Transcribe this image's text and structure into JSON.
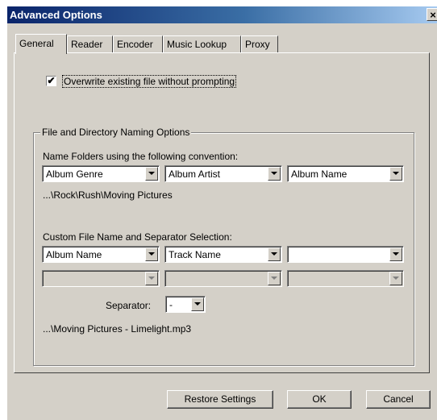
{
  "window": {
    "title": "Advanced Options",
    "close_glyph": "×"
  },
  "tabs": [
    {
      "label": "General",
      "active": true
    },
    {
      "label": "Reader"
    },
    {
      "label": "Encoder"
    },
    {
      "label": "Music Lookup"
    },
    {
      "label": "Proxy"
    }
  ],
  "overwrite": {
    "checked": true,
    "check_glyph": "✔",
    "label": "Overwrite existing file without prompting"
  },
  "naming": {
    "group_title": "File and Directory Naming Options",
    "folder_label": "Name Folders using the following convention:",
    "folder_fields": [
      "Album Genre",
      "Album Artist",
      "Album Name"
    ],
    "folder_preview": "...\\Rock\\Rush\\Moving Pictures",
    "custom_label": "Custom File Name and Separator Selection:",
    "custom_fields": [
      "Album Name",
      "Track Name",
      ""
    ],
    "custom_fields_row2": [
      "",
      "",
      ""
    ],
    "separator_label": "Separator:",
    "separator_value": "-",
    "file_preview": "...\\Moving Pictures - Limelight.mp3"
  },
  "buttons": {
    "restore": "Restore Settings",
    "ok": "OK",
    "cancel": "Cancel"
  }
}
